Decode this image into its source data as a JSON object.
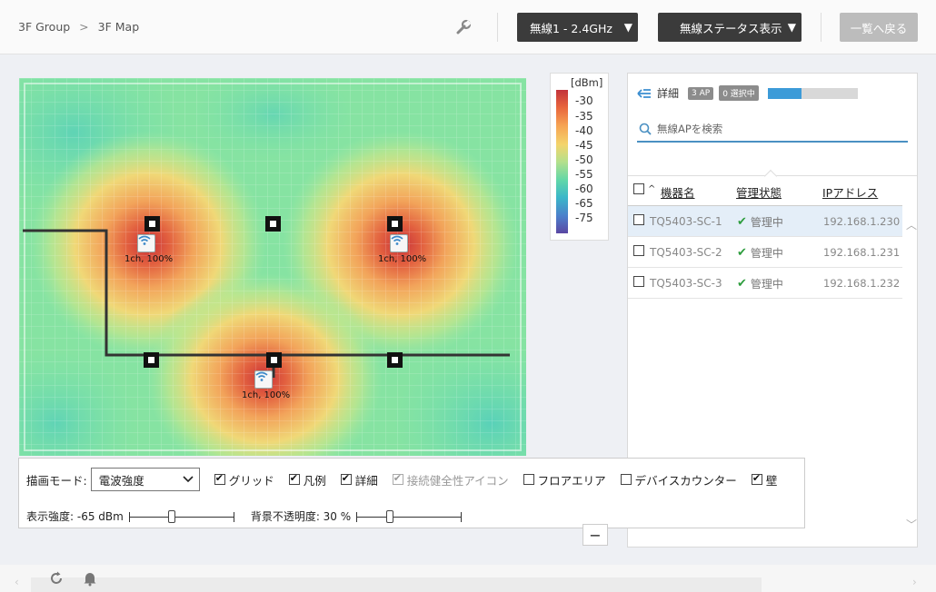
{
  "breadcrumb": {
    "group": "3F Group",
    "separator": ">",
    "map": "3F Map"
  },
  "toolbar": {
    "band_label": "無線1 - 2.4GHz",
    "status_label": "無線ステータス表示",
    "back_label": "一覧へ戻る"
  },
  "legend": {
    "unit": "[dBm]",
    "ticks": [
      "-30",
      "-35",
      "-40",
      "-45",
      "-50",
      "-55",
      "-60",
      "-65",
      "-75"
    ]
  },
  "map": {
    "ap_labels": [
      "1ch, 100%",
      "1ch, 100%",
      "1ch, 100%"
    ]
  },
  "panel": {
    "detail_label": "詳細",
    "ap_count_badge": "3 AP",
    "selected_badge": "0 選択中",
    "progress_fraction": 0.38,
    "search_placeholder": "無線APを検索",
    "headers": {
      "sort_indicator": "^",
      "name": "機器名",
      "status": "管理状態",
      "ip": "IPアドレス"
    },
    "rows": [
      {
        "name": "TQ5403-SC-1",
        "status": "管理中",
        "ip": "192.168.1.230"
      },
      {
        "name": "TQ5403-SC-2",
        "status": "管理中",
        "ip": "192.168.1.231"
      },
      {
        "name": "TQ5403-SC-3",
        "status": "管理中",
        "ip": "192.168.1.232"
      }
    ]
  },
  "controls": {
    "mode_label": "描画モード:",
    "mode_value": "電波強度",
    "checkboxes": [
      {
        "label": "グリッド",
        "checked": true,
        "disabled": false
      },
      {
        "label": "凡例",
        "checked": true,
        "disabled": false
      },
      {
        "label": "詳細",
        "checked": true,
        "disabled": false
      },
      {
        "label": "接続健全性アイコン",
        "checked": true,
        "disabled": true
      },
      {
        "label": "フロアエリア",
        "checked": false,
        "disabled": false
      },
      {
        "label": "デバイスカウンター",
        "checked": false,
        "disabled": false
      },
      {
        "label": "壁",
        "checked": true,
        "disabled": false
      }
    ],
    "strength_label": "表示強度: -65 dBm",
    "strength_fraction": 0.4,
    "opacity_label": "背景不透明度: 30 %",
    "opacity_fraction": 0.3,
    "zoom_minus": "−"
  },
  "colors": {
    "accent": "#3c9bd8",
    "dark_button": "#3b3b3b",
    "check_green": "#2e9d3e"
  }
}
